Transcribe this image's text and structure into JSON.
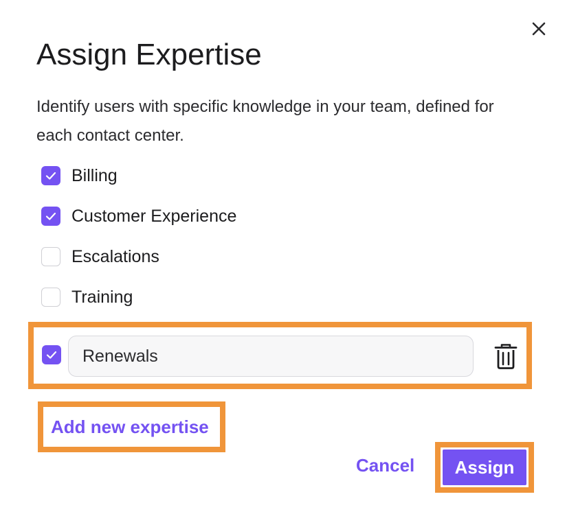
{
  "dialog": {
    "title": "Assign Expertise",
    "description": "Identify users with specific knowledge in your team, defined for each contact center."
  },
  "options": [
    {
      "label": "Billing",
      "checked": true
    },
    {
      "label": "Customer Experience",
      "checked": true
    },
    {
      "label": "Escalations",
      "checked": false
    },
    {
      "label": "Training",
      "checked": false
    }
  ],
  "new_expertise": {
    "checked": true,
    "value": "Renewals"
  },
  "actions": {
    "add_new": "Add new expertise",
    "cancel": "Cancel",
    "assign": "Assign"
  },
  "colors": {
    "accent": "#7452f2",
    "highlight": "#f0953a"
  },
  "icons": [
    "close-icon",
    "check-icon",
    "trash-icon"
  ]
}
